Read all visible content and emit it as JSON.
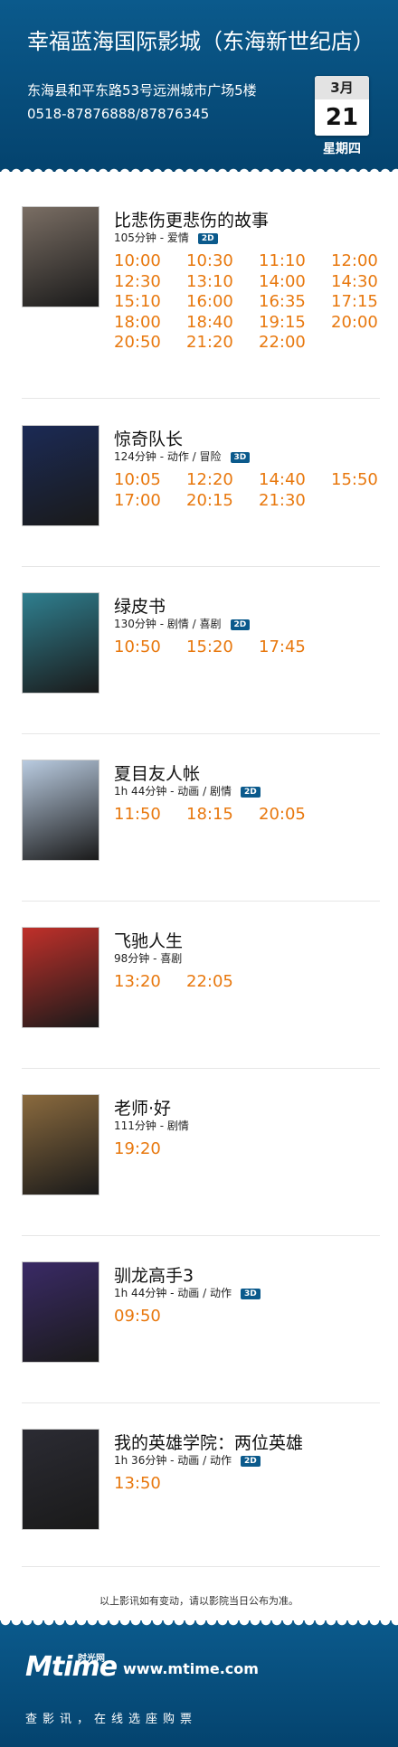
{
  "header": {
    "cinema_name": "幸福蓝海国际影城（东海新世纪店）",
    "address": "东海县和平东路53号远洲城市广场5楼",
    "phone": "0518-87876888/87876345",
    "month": "3月",
    "day": "21",
    "weekday": "星期四"
  },
  "movies": [
    {
      "title": "比悲伤更悲伤的故事",
      "meta": "105分钟 - 爱情",
      "format": "2D",
      "poster_color": "#7a6e64",
      "times": [
        "10:00",
        "10:30",
        "11:10",
        "12:00",
        "12:30",
        "13:10",
        "14:00",
        "14:30",
        "15:10",
        "16:00",
        "16:35",
        "17:15",
        "18:00",
        "18:40",
        "19:15",
        "20:00",
        "20:50",
        "21:20",
        "22:00"
      ]
    },
    {
      "title": "惊奇队长",
      "meta": "124分钟 - 动作 / 冒险",
      "format": "3D",
      "poster_color": "#1b2a55",
      "times": [
        "10:05",
        "12:20",
        "14:40",
        "15:50",
        "17:00",
        "20:15",
        "21:30"
      ]
    },
    {
      "title": "绿皮书",
      "meta": "130分钟 - 剧情 / 喜剧",
      "format": "2D",
      "poster_color": "#2f7f8f",
      "times": [
        "10:50",
        "15:20",
        "17:45"
      ]
    },
    {
      "title": "夏目友人帐",
      "meta": "1h 44分钟 - 动画 / 剧情",
      "format": "2D",
      "poster_color": "#b9cbe0",
      "times": [
        "11:50",
        "18:15",
        "20:05"
      ]
    },
    {
      "title": "飞驰人生",
      "meta": "98分钟 - 喜剧",
      "format": "",
      "poster_color": "#c0302a",
      "times": [
        "13:20",
        "22:05"
      ]
    },
    {
      "title": "老师·好",
      "meta": "111分钟 - 剧情",
      "format": "",
      "poster_color": "#8a6a3e",
      "times": [
        "19:20"
      ]
    },
    {
      "title": "驯龙高手3",
      "meta": "1h 44分钟 - 动画 / 动作",
      "format": "3D",
      "poster_color": "#3a2a66",
      "times": [
        "09:50"
      ]
    },
    {
      "title": "我的英雄学院：两位英雄",
      "meta": "1h 36分钟 - 动画 / 动作",
      "format": "2D",
      "poster_color": "#2b2b33",
      "times": [
        "13:50"
      ]
    }
  ],
  "notice": "以上影讯如有变动，请以影院当日公布为准。",
  "footer": {
    "logo": "Mtime",
    "logo_cn": "时光网",
    "site": "www.mtime.com",
    "slogan": "查影讯，在线选座购票"
  }
}
